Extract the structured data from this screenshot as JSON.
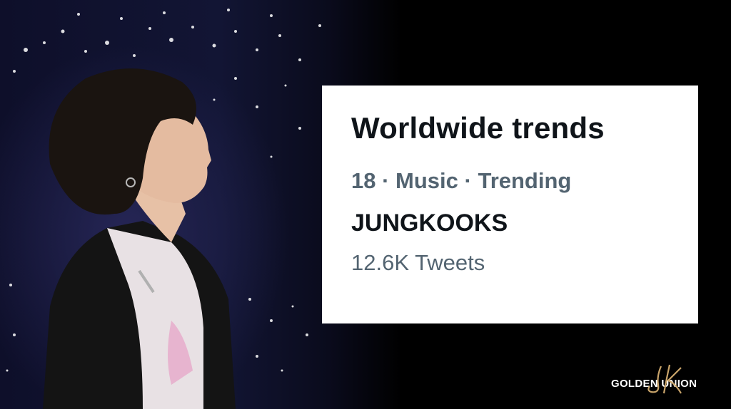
{
  "card": {
    "title": "Worldwide trends",
    "rank": "18",
    "category": "Music",
    "status": "Trending",
    "topic": "JUNGKOOKS",
    "tweet_count": "12.6K Tweets"
  },
  "brand": {
    "name": "GOLDEN UNION",
    "logo_initials": "JK",
    "logo_color": "#c9a46a"
  },
  "colors": {
    "card_bg": "#ffffff",
    "title": "#0f1419",
    "secondary": "#536471"
  }
}
